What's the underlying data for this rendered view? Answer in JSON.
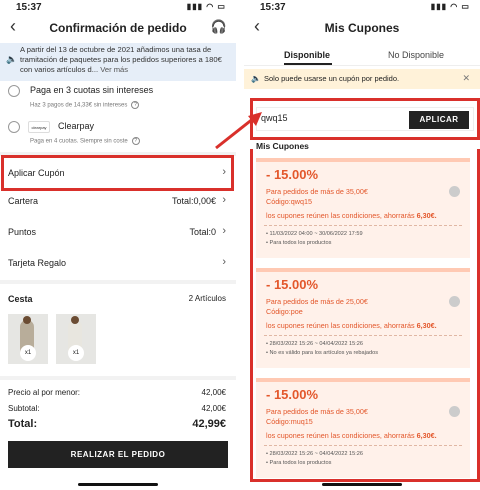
{
  "left": {
    "status": {
      "time": "15:37"
    },
    "title": "Confirmación de pedido",
    "notice": {
      "text": "A partir del 13 de octubre de 2021 añadimos una tasa de tramitación de paquetes para los pedidos superiores a 180€ con varios artículos d...",
      "more": "Ver más"
    },
    "payments": [
      {
        "label": "Paga en 3 cuotas sin intereses",
        "sub": "Haz 3 pagos de 14,33€ sin intereses",
        "logo": "Klarna"
      },
      {
        "label": "Clearpay",
        "sub": "Paga en 4 cuotas. Siempre sin coste",
        "logo": "clearpay"
      }
    ],
    "coupon_row": {
      "label": "Aplicar Cupón"
    },
    "rows": [
      {
        "label": "Cartera",
        "value": "Total:0,00€"
      },
      {
        "label": "Puntos",
        "value": "Total:0"
      },
      {
        "label": "Tarjeta Regalo",
        "value": ""
      }
    ],
    "cesta": {
      "title": "Cesta",
      "count": "2 Artículos",
      "items": [
        {
          "qty": "x1"
        },
        {
          "qty": "x1"
        }
      ]
    },
    "summary": {
      "retail_label": "Precio al por menor:",
      "retail_value": "42,00€",
      "subtotal_label": "Subtotal:",
      "subtotal_value": "42,00€",
      "total_label": "Total:",
      "total_value": "42,99€"
    },
    "order_button": "REALIZAR EL PEDIDO"
  },
  "right": {
    "status": {
      "time": "15:37"
    },
    "title": "Mis Cupones",
    "tabs": [
      {
        "label": "Disponible"
      },
      {
        "label": "No Disponible"
      }
    ],
    "tip": "Solo puede usarse un cupón por pedido.",
    "code_value": "qwq15",
    "apply_button": "APLICAR",
    "list_title": "Mis Cupones",
    "coupons": [
      {
        "discount": "- 15.00%",
        "min": "Para pedidos de más de 35,00€",
        "code": "Código:qwq15",
        "condition": "los cupones reúnen las condiciones, ahorrarás",
        "saving": "6,30€.",
        "date": "• 11/03/2022 04:00 ~ 30/06/2022 17:59",
        "note": "• Para todos los productos"
      },
      {
        "discount": "- 15.00%",
        "min": "Para pedidos de más de 25,00€",
        "code": "Código:poe",
        "condition": "los cupones reúnen las condiciones, ahorrarás",
        "saving": "6,30€.",
        "date": "• 28/03/2022 15:26 ~ 04/04/2022 15:26",
        "note": "• No es válido para los artículos ya rebajados"
      },
      {
        "discount": "- 15.00%",
        "min": "Para pedidos de más de 35,00€",
        "code": "Código:muq15",
        "condition": "los cupones reúnen las condiciones, ahorrarás",
        "saving": "6,30€.",
        "date": "• 28/03/2022 15:26 ~ 04/04/2022 15:26",
        "note": "• Para todos los productos"
      }
    ]
  },
  "colors": {
    "accent": "#e3572b",
    "highlight": "#d9302b",
    "notice_bg": "#e6eef8",
    "tip_bg": "#fff2d9",
    "coupon_bg": "#fff1ea"
  }
}
